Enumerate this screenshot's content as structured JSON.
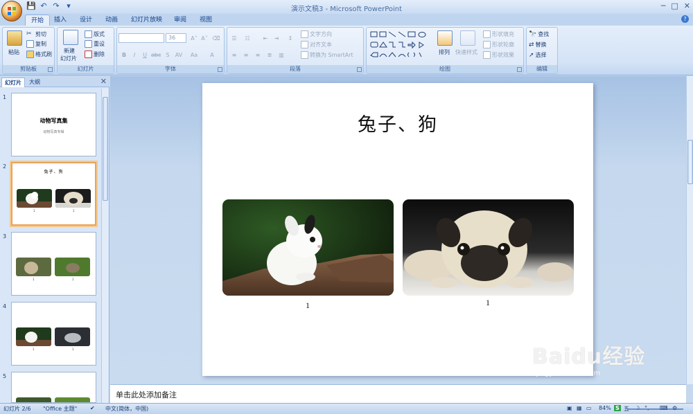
{
  "window": {
    "title": "演示文稿3 - Microsoft PowerPoint"
  },
  "tabs": [
    "开始",
    "插入",
    "设计",
    "动画",
    "幻灯片放映",
    "审阅",
    "视图"
  ],
  "ribbon": {
    "clipboard": {
      "label": "剪贴板",
      "paste": "粘贴",
      "cut": "剪切",
      "copy": "复制",
      "format_painter": "格式刷"
    },
    "slides": {
      "label": "幻灯片",
      "new_slide_1": "新建",
      "new_slide_2": "幻灯片",
      "layout": "版式",
      "reset": "重设",
      "delete": "删除"
    },
    "font": {
      "label": "字体",
      "font_size": "36"
    },
    "paragraph": {
      "label": "段落",
      "text_direction": "文字方向",
      "align_text": "对齐文本",
      "smartart": "转换为 SmartArt"
    },
    "drawing": {
      "label": "绘图",
      "arrange": "排列",
      "quick_styles": "快速样式",
      "shape_fill": "形状填充",
      "shape_outline": "形状轮廓",
      "shape_effects": "形状效果"
    },
    "editing": {
      "label": "编辑",
      "find": "查找",
      "replace": "替换",
      "select": "选择"
    }
  },
  "left_pane": {
    "tab_slides": "幻灯片",
    "tab_outline": "大纲",
    "slides": [
      {
        "num": "1",
        "title": "动物写真集",
        "subtitle": "动物写真专辑"
      },
      {
        "num": "2",
        "title": "兔子、狗",
        "cap1": "1",
        "cap2": "1"
      },
      {
        "num": "3",
        "cap1": "1",
        "cap2": "1"
      },
      {
        "num": "4",
        "cap1": "1",
        "cap2": "1"
      },
      {
        "num": "5"
      }
    ]
  },
  "slide": {
    "title": "兔子、狗",
    "caption_left": "1",
    "caption_right": "1"
  },
  "notes": {
    "placeholder": "单击此处添加备注"
  },
  "status": {
    "slide_count": "幻灯片 2/6",
    "theme": "\"Office 主题\"",
    "language": "中文(简体，中国)",
    "zoom": "84%",
    "ime": "五"
  },
  "watermark": {
    "brand": "Baidu经验",
    "url": "jingyan.baidu.com"
  }
}
